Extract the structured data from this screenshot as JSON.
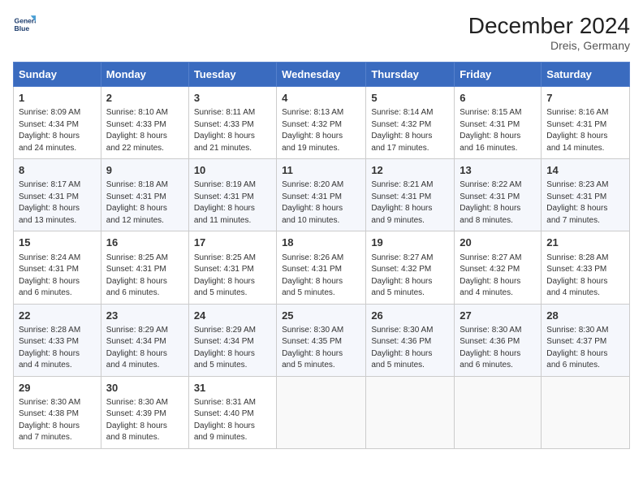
{
  "header": {
    "logo_line1": "General",
    "logo_line2": "Blue",
    "title": "December 2024",
    "subtitle": "Dreis, Germany"
  },
  "columns": [
    "Sunday",
    "Monday",
    "Tuesday",
    "Wednesday",
    "Thursday",
    "Friday",
    "Saturday"
  ],
  "weeks": [
    [
      {
        "day": "1",
        "lines": [
          "Sunrise: 8:09 AM",
          "Sunset: 4:34 PM",
          "Daylight: 8 hours",
          "and 24 minutes."
        ]
      },
      {
        "day": "2",
        "lines": [
          "Sunrise: 8:10 AM",
          "Sunset: 4:33 PM",
          "Daylight: 8 hours",
          "and 22 minutes."
        ]
      },
      {
        "day": "3",
        "lines": [
          "Sunrise: 8:11 AM",
          "Sunset: 4:33 PM",
          "Daylight: 8 hours",
          "and 21 minutes."
        ]
      },
      {
        "day": "4",
        "lines": [
          "Sunrise: 8:13 AM",
          "Sunset: 4:32 PM",
          "Daylight: 8 hours",
          "and 19 minutes."
        ]
      },
      {
        "day": "5",
        "lines": [
          "Sunrise: 8:14 AM",
          "Sunset: 4:32 PM",
          "Daylight: 8 hours",
          "and 17 minutes."
        ]
      },
      {
        "day": "6",
        "lines": [
          "Sunrise: 8:15 AM",
          "Sunset: 4:31 PM",
          "Daylight: 8 hours",
          "and 16 minutes."
        ]
      },
      {
        "day": "7",
        "lines": [
          "Sunrise: 8:16 AM",
          "Sunset: 4:31 PM",
          "Daylight: 8 hours",
          "and 14 minutes."
        ]
      }
    ],
    [
      {
        "day": "8",
        "lines": [
          "Sunrise: 8:17 AM",
          "Sunset: 4:31 PM",
          "Daylight: 8 hours",
          "and 13 minutes."
        ]
      },
      {
        "day": "9",
        "lines": [
          "Sunrise: 8:18 AM",
          "Sunset: 4:31 PM",
          "Daylight: 8 hours",
          "and 12 minutes."
        ]
      },
      {
        "day": "10",
        "lines": [
          "Sunrise: 8:19 AM",
          "Sunset: 4:31 PM",
          "Daylight: 8 hours",
          "and 11 minutes."
        ]
      },
      {
        "day": "11",
        "lines": [
          "Sunrise: 8:20 AM",
          "Sunset: 4:31 PM",
          "Daylight: 8 hours",
          "and 10 minutes."
        ]
      },
      {
        "day": "12",
        "lines": [
          "Sunrise: 8:21 AM",
          "Sunset: 4:31 PM",
          "Daylight: 8 hours",
          "and 9 minutes."
        ]
      },
      {
        "day": "13",
        "lines": [
          "Sunrise: 8:22 AM",
          "Sunset: 4:31 PM",
          "Daylight: 8 hours",
          "and 8 minutes."
        ]
      },
      {
        "day": "14",
        "lines": [
          "Sunrise: 8:23 AM",
          "Sunset: 4:31 PM",
          "Daylight: 8 hours",
          "and 7 minutes."
        ]
      }
    ],
    [
      {
        "day": "15",
        "lines": [
          "Sunrise: 8:24 AM",
          "Sunset: 4:31 PM",
          "Daylight: 8 hours",
          "and 6 minutes."
        ]
      },
      {
        "day": "16",
        "lines": [
          "Sunrise: 8:25 AM",
          "Sunset: 4:31 PM",
          "Daylight: 8 hours",
          "and 6 minutes."
        ]
      },
      {
        "day": "17",
        "lines": [
          "Sunrise: 8:25 AM",
          "Sunset: 4:31 PM",
          "Daylight: 8 hours",
          "and 5 minutes."
        ]
      },
      {
        "day": "18",
        "lines": [
          "Sunrise: 8:26 AM",
          "Sunset: 4:31 PM",
          "Daylight: 8 hours",
          "and 5 minutes."
        ]
      },
      {
        "day": "19",
        "lines": [
          "Sunrise: 8:27 AM",
          "Sunset: 4:32 PM",
          "Daylight: 8 hours",
          "and 5 minutes."
        ]
      },
      {
        "day": "20",
        "lines": [
          "Sunrise: 8:27 AM",
          "Sunset: 4:32 PM",
          "Daylight: 8 hours",
          "and 4 minutes."
        ]
      },
      {
        "day": "21",
        "lines": [
          "Sunrise: 8:28 AM",
          "Sunset: 4:33 PM",
          "Daylight: 8 hours",
          "and 4 minutes."
        ]
      }
    ],
    [
      {
        "day": "22",
        "lines": [
          "Sunrise: 8:28 AM",
          "Sunset: 4:33 PM",
          "Daylight: 8 hours",
          "and 4 minutes."
        ]
      },
      {
        "day": "23",
        "lines": [
          "Sunrise: 8:29 AM",
          "Sunset: 4:34 PM",
          "Daylight: 8 hours",
          "and 4 minutes."
        ]
      },
      {
        "day": "24",
        "lines": [
          "Sunrise: 8:29 AM",
          "Sunset: 4:34 PM",
          "Daylight: 8 hours",
          "and 5 minutes."
        ]
      },
      {
        "day": "25",
        "lines": [
          "Sunrise: 8:30 AM",
          "Sunset: 4:35 PM",
          "Daylight: 8 hours",
          "and 5 minutes."
        ]
      },
      {
        "day": "26",
        "lines": [
          "Sunrise: 8:30 AM",
          "Sunset: 4:36 PM",
          "Daylight: 8 hours",
          "and 5 minutes."
        ]
      },
      {
        "day": "27",
        "lines": [
          "Sunrise: 8:30 AM",
          "Sunset: 4:36 PM",
          "Daylight: 8 hours",
          "and 6 minutes."
        ]
      },
      {
        "day": "28",
        "lines": [
          "Sunrise: 8:30 AM",
          "Sunset: 4:37 PM",
          "Daylight: 8 hours",
          "and 6 minutes."
        ]
      }
    ],
    [
      {
        "day": "29",
        "lines": [
          "Sunrise: 8:30 AM",
          "Sunset: 4:38 PM",
          "Daylight: 8 hours",
          "and 7 minutes."
        ]
      },
      {
        "day": "30",
        "lines": [
          "Sunrise: 8:30 AM",
          "Sunset: 4:39 PM",
          "Daylight: 8 hours",
          "and 8 minutes."
        ]
      },
      {
        "day": "31",
        "lines": [
          "Sunrise: 8:31 AM",
          "Sunset: 4:40 PM",
          "Daylight: 8 hours",
          "and 9 minutes."
        ]
      },
      null,
      null,
      null,
      null
    ]
  ]
}
